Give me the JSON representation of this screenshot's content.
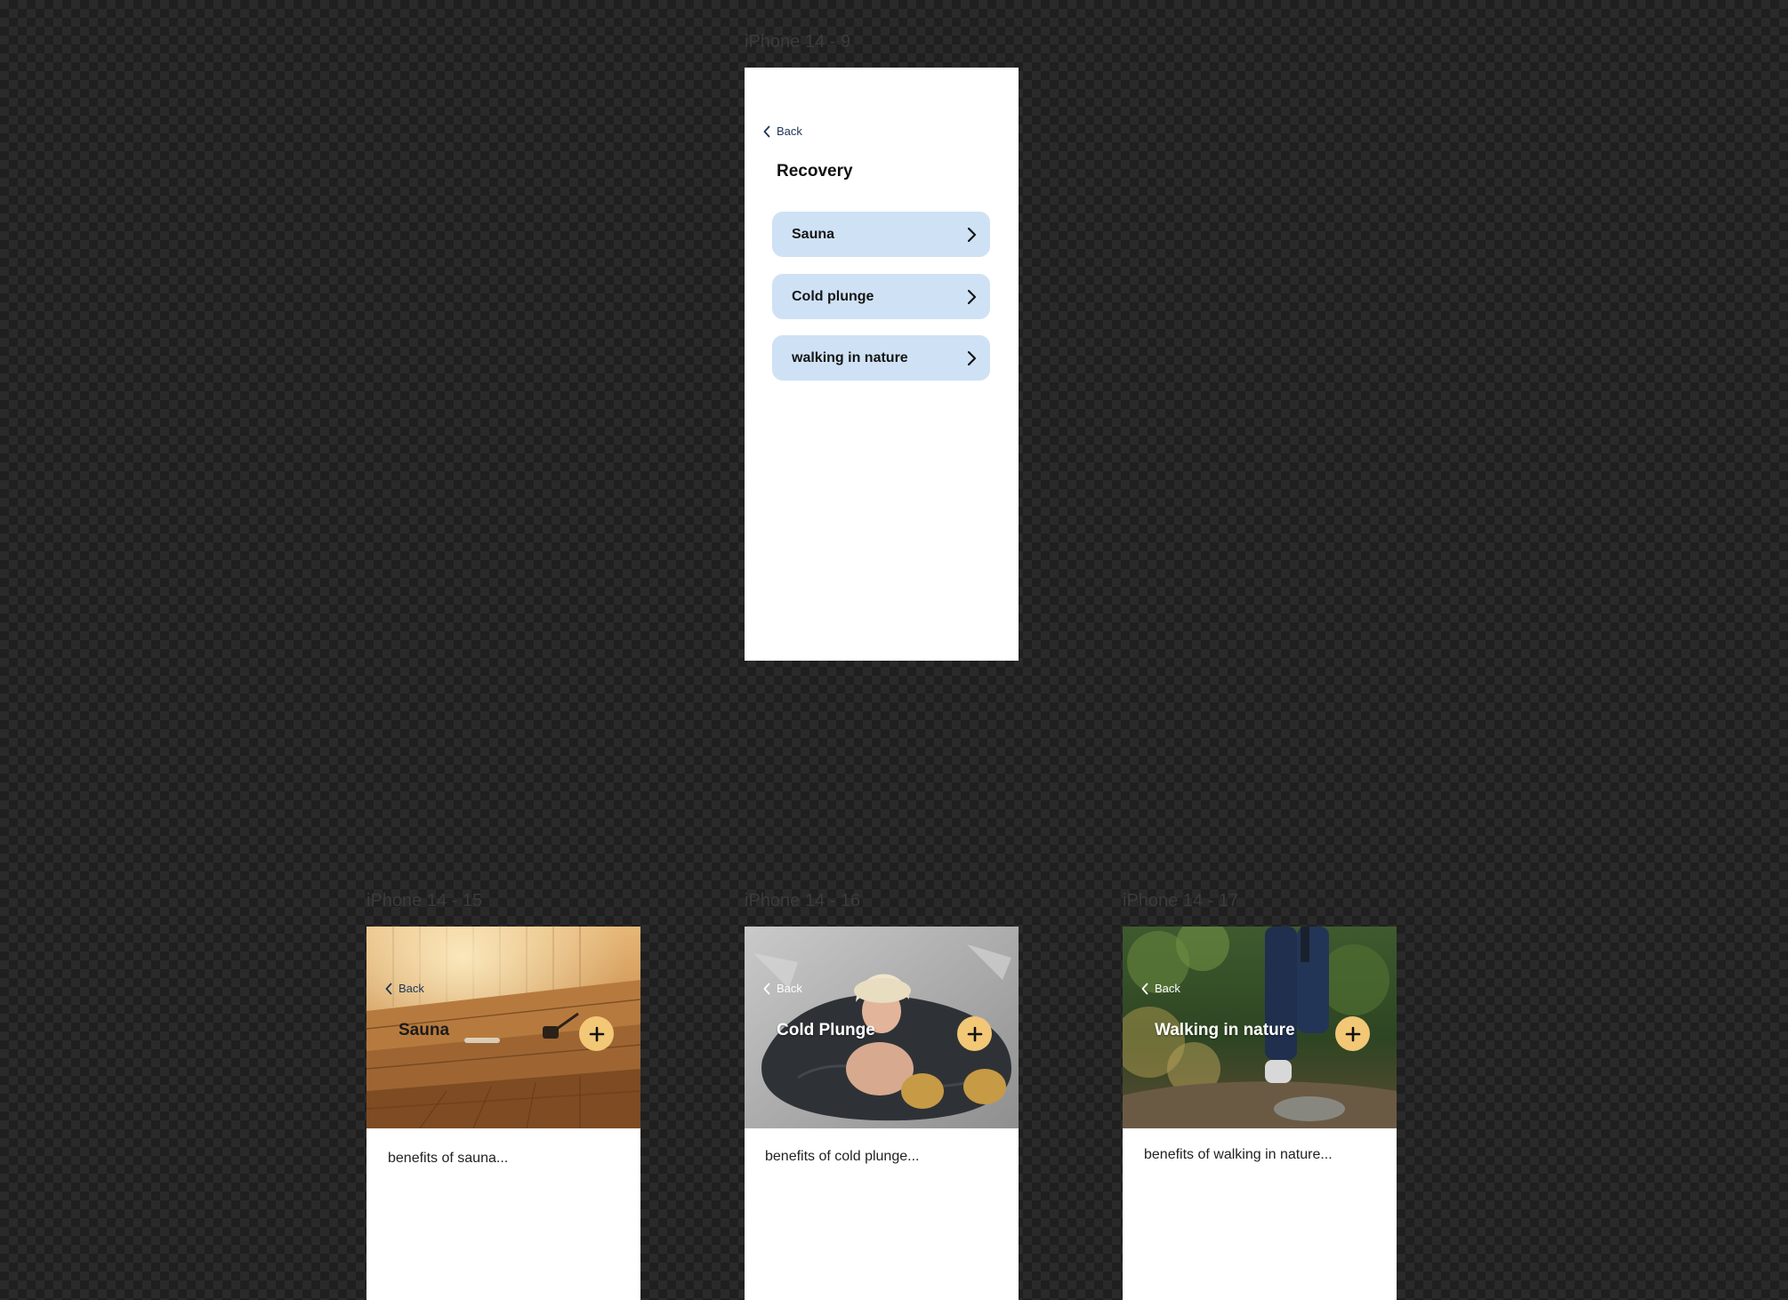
{
  "frames": {
    "main": {
      "label": "iPhone 14 - 9",
      "back_label": "Back",
      "title": "Recovery",
      "items": [
        {
          "label": "Sauna"
        },
        {
          "label": "Cold plunge"
        },
        {
          "label": "walking in nature"
        }
      ]
    },
    "sauna": {
      "label": "iPhone 14 - 15",
      "back_label": "Back",
      "title": "Sauna",
      "body": "benefits of sauna..."
    },
    "plunge": {
      "label": "iPhone 14 - 16",
      "back_label": "Back",
      "title": "Cold Plunge",
      "body": "benefits of cold plunge..."
    },
    "nature": {
      "label": "iPhone 14 - 17",
      "back_label": "Back",
      "title": "Walking in nature",
      "body": "benefits of walking in nature..."
    }
  },
  "icons": {
    "back": "chevron-left-icon",
    "row_arrow": "chevron-right-icon",
    "add": "plus-icon"
  },
  "colors": {
    "list_item_bg": "#cfe2f5",
    "add_button_bg": "#f2c776",
    "back_link_color": "#1c3556"
  }
}
